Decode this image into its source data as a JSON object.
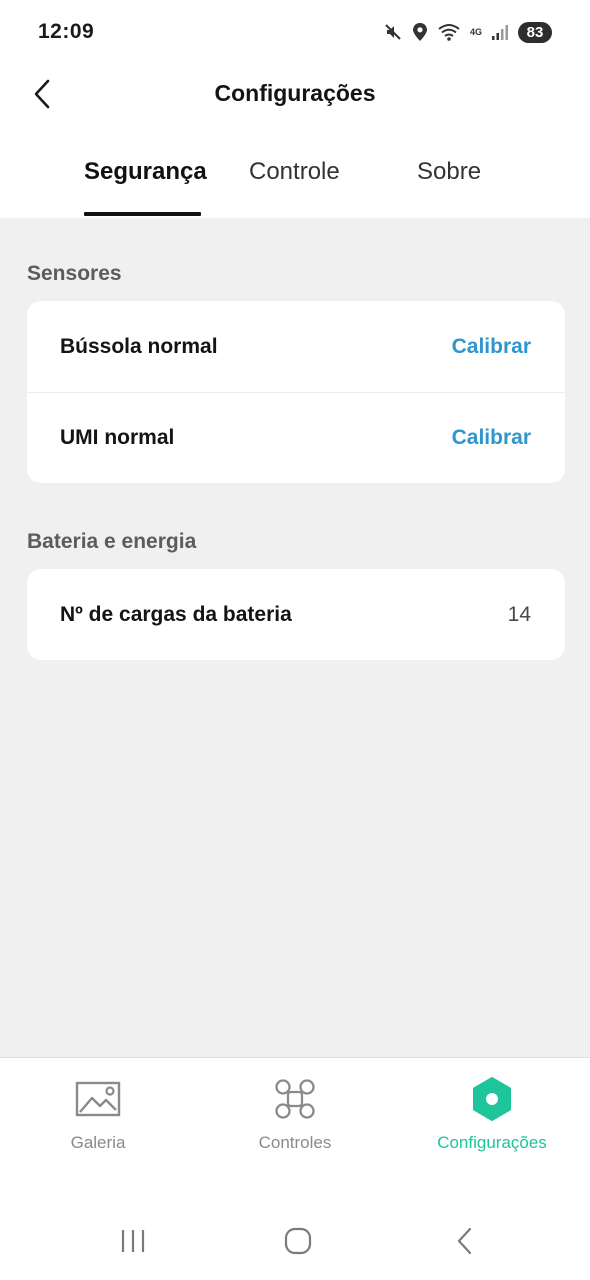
{
  "status_bar": {
    "time": "12:09",
    "network_label": "4G",
    "battery": "83",
    "icons": [
      "mute-icon",
      "location-icon",
      "wifi-icon",
      "network-4g-icon",
      "signal-icon",
      "battery-icon"
    ]
  },
  "header": {
    "title": "Configurações",
    "back_icon": "chevron-left-icon"
  },
  "tabs": [
    {
      "label": "Segurança",
      "active": true
    },
    {
      "label": "Controle",
      "active": false
    },
    {
      "label": "Sobre",
      "active": false
    }
  ],
  "sections": [
    {
      "title": "Sensores",
      "rows": [
        {
          "label": "Bússola normal",
          "action": "Calibrar"
        },
        {
          "label": "UMI normal",
          "action": "Calibrar"
        }
      ]
    },
    {
      "title": "Bateria e energia",
      "rows": [
        {
          "label": "Nº de cargas da bateria",
          "value": "14"
        }
      ]
    }
  ],
  "bottom_nav": [
    {
      "label": "Galeria",
      "icon": "gallery-icon",
      "active": false
    },
    {
      "label": "Controles",
      "icon": "drone-icon",
      "active": false
    },
    {
      "label": "Configurações",
      "icon": "settings-hexagon-icon",
      "active": true
    }
  ],
  "colors": {
    "accent": "#1ec49a",
    "link": "#2e95cf",
    "background": "#f0f0f0",
    "card": "#ffffff"
  }
}
